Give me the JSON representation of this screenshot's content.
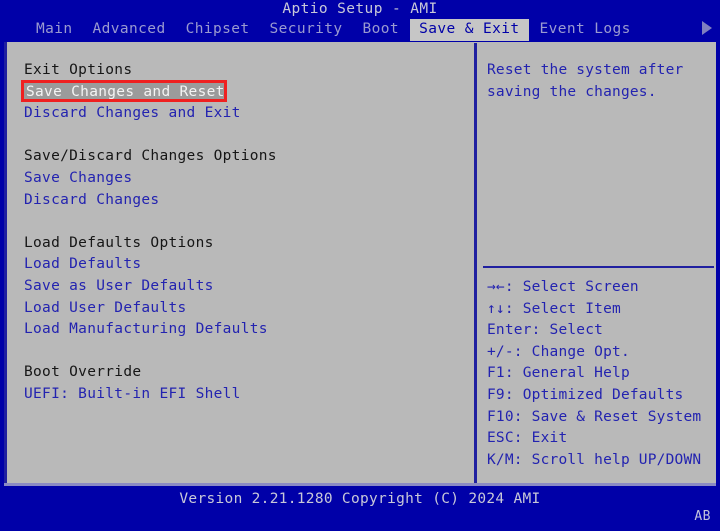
{
  "window": {
    "title": "Aptio Setup - AMI"
  },
  "tabs": [
    {
      "label": "Main",
      "active": false
    },
    {
      "label": "Advanced",
      "active": false
    },
    {
      "label": "Chipset",
      "active": false
    },
    {
      "label": "Security",
      "active": false
    },
    {
      "label": "Boot",
      "active": false
    },
    {
      "label": "Save & Exit",
      "active": true
    },
    {
      "label": "Event Logs",
      "active": false
    }
  ],
  "tab_scroll_icon": "triangle-right-icon",
  "menu": [
    {
      "text": "Exit Options",
      "type": "header"
    },
    {
      "text": "Save Changes and Reset",
      "type": "selected"
    },
    {
      "text": "Discard Changes and Exit",
      "type": "item"
    },
    {
      "text": "",
      "type": "spacer"
    },
    {
      "text": "Save/Discard Changes Options",
      "type": "header"
    },
    {
      "text": "Save Changes",
      "type": "item"
    },
    {
      "text": "Discard Changes",
      "type": "item"
    },
    {
      "text": "",
      "type": "spacer"
    },
    {
      "text": "Load Defaults Options",
      "type": "header"
    },
    {
      "text": "Load Defaults",
      "type": "item"
    },
    {
      "text": "Save as User Defaults",
      "type": "item"
    },
    {
      "text": "Load User Defaults",
      "type": "item"
    },
    {
      "text": "Load Manufacturing Defaults",
      "type": "item"
    },
    {
      "text": "",
      "type": "spacer"
    },
    {
      "text": "Boot Override",
      "type": "header"
    },
    {
      "text": "UEFI: Built-in EFI Shell",
      "type": "item"
    }
  ],
  "help": {
    "lines": [
      "Reset the system after",
      "saving the changes."
    ]
  },
  "key_legend": [
    "→←: Select Screen",
    "↑↓: Select Item",
    "Enter: Select",
    "+/-: Change Opt.",
    "F1: General Help",
    "F9: Optimized Defaults",
    "F10: Save & Reset System",
    "ESC: Exit",
    "K/M: Scroll help UP/DOWN"
  ],
  "footer": {
    "version": "Version 2.21.1280 Copyright (C) 2024 AMI",
    "corner_tag": "AB"
  },
  "colors": {
    "background_blue": "#0000a8",
    "panel_gray": "#b9b9b9",
    "item_blue": "#2323b0",
    "header_black": "#161616",
    "selected_text": "#f4f4f4",
    "selected_bar": "#9b9b9b",
    "annotation_red": "#ef2020",
    "active_tab_bg": "#c6c6c6"
  }
}
